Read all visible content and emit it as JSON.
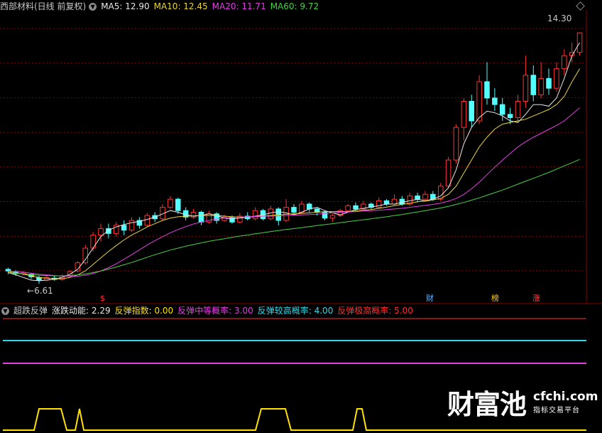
{
  "header": {
    "title": "西部材料(日线 前复权)",
    "ma": [
      {
        "label": "MA5: 12.90",
        "color": "#e8e8e8"
      },
      {
        "label": "MA10: 12.45",
        "color": "#e8d63a"
      },
      {
        "label": "MA20: 11.71",
        "color": "#e23ee2"
      },
      {
        "label": "MA60: 9.72",
        "color": "#46d246"
      }
    ]
  },
  "price_labels": {
    "high": "14.30",
    "low": "6.61"
  },
  "event_marks": [
    {
      "label": "$",
      "color": "#ff3030"
    },
    {
      "label": "财",
      "color": "#5fb4ff"
    },
    {
      "label": "榜",
      "color": "#ffd200"
    },
    {
      "label": "涨",
      "color": "#ff5050"
    }
  ],
  "indicator": {
    "title": "超跌反弹",
    "items": [
      {
        "label": "涨跌动能: 2.29",
        "color": "#e8e8e8"
      },
      {
        "label": "反弹指数: 0.00",
        "color": "#ffe000"
      },
      {
        "label": "反弹中等概率: 3.00",
        "color": "#e23ee2"
      },
      {
        "label": "反弹较高概率: 4.00",
        "color": "#30d8e8"
      },
      {
        "label": "反弹极高概率: 5.00",
        "color": "#ff3030"
      }
    ]
  },
  "watermark": {
    "brand": "财富池",
    "domain": "cfchi.com",
    "tagline": "指标交易平台"
  },
  "colors": {
    "up": "#ff3232",
    "down": "#54ffff",
    "grid": "#8b0000",
    "ma5": "#e8e8e8",
    "ma10": "#e8d63a",
    "ma20": "#e23ee2",
    "ma60": "#46d246"
  },
  "chart_data": {
    "type": "candlestick",
    "y_range": [
      6.0,
      15.0
    ],
    "grid": true,
    "series": [
      {
        "name": "MA5",
        "values": [
          6.95,
          6.88,
          6.8,
          6.72,
          6.7,
          6.72,
          6.75,
          6.8,
          6.9,
          7.05,
          7.35,
          7.7,
          8.05,
          8.25,
          8.35,
          8.42,
          8.48,
          8.52,
          8.58,
          8.65,
          8.75,
          8.85,
          8.8,
          8.72,
          8.68,
          8.7,
          8.75,
          8.7,
          8.62,
          8.6,
          8.62,
          8.65,
          8.68,
          8.72,
          8.78,
          8.82,
          8.78,
          8.72,
          8.8,
          8.9,
          8.95,
          8.85,
          8.78,
          8.72,
          8.8,
          8.88,
          8.92,
          8.96,
          9.0,
          9.05,
          9.05,
          9.1,
          9.15,
          9.2,
          9.15,
          9.2,
          9.3,
          9.55,
          10.1,
          10.9,
          11.4,
          11.7,
          11.9,
          11.85,
          11.75,
          11.6,
          11.55,
          11.8,
          12.1,
          12.1,
          12.05,
          12.3,
          12.9,
          13.6,
          14.0
        ]
      },
      {
        "name": "MA10",
        "values": [
          6.98,
          6.94,
          6.9,
          6.85,
          6.8,
          6.78,
          6.76,
          6.76,
          6.8,
          6.88,
          7.0,
          7.2,
          7.4,
          7.6,
          7.78,
          7.95,
          8.1,
          8.22,
          8.35,
          8.45,
          8.55,
          8.62,
          8.66,
          8.68,
          8.69,
          8.7,
          8.7,
          8.7,
          8.68,
          8.66,
          8.65,
          8.65,
          8.66,
          8.68,
          8.7,
          8.72,
          8.74,
          8.75,
          8.76,
          8.78,
          8.8,
          8.82,
          8.82,
          8.82,
          8.82,
          8.84,
          8.86,
          8.88,
          8.92,
          8.96,
          9.0,
          9.04,
          9.08,
          9.12,
          9.14,
          9.18,
          9.22,
          9.35,
          9.6,
          10.0,
          10.4,
          10.8,
          11.1,
          11.35,
          11.5,
          11.55,
          11.6,
          11.65,
          11.75,
          11.85,
          11.95,
          12.1,
          12.35,
          12.8,
          13.2
        ]
      },
      {
        "name": "MA20",
        "values": [
          7.0,
          6.98,
          6.96,
          6.93,
          6.9,
          6.88,
          6.86,
          6.84,
          6.83,
          6.84,
          6.87,
          6.92,
          7.0,
          7.1,
          7.22,
          7.36,
          7.5,
          7.65,
          7.8,
          7.93,
          8.05,
          8.17,
          8.27,
          8.36,
          8.44,
          8.5,
          8.55,
          8.59,
          8.62,
          8.64,
          8.65,
          8.66,
          8.67,
          8.68,
          8.68,
          8.69,
          8.7,
          8.71,
          8.72,
          8.73,
          8.74,
          8.76,
          8.78,
          8.8,
          8.81,
          8.82,
          8.84,
          8.85,
          8.86,
          8.88,
          8.9,
          8.92,
          8.95,
          8.98,
          9.01,
          9.04,
          9.08,
          9.14,
          9.22,
          9.35,
          9.52,
          9.72,
          9.95,
          10.18,
          10.4,
          10.6,
          10.8,
          10.96,
          11.1,
          11.22,
          11.34,
          11.46,
          11.6,
          11.8,
          12.0
        ]
      },
      {
        "name": "MA60",
        "values": [
          6.95,
          6.93,
          6.91,
          6.89,
          6.87,
          6.86,
          6.85,
          6.85,
          6.86,
          6.88,
          6.91,
          6.95,
          7.0,
          7.06,
          7.12,
          7.19,
          7.26,
          7.34,
          7.42,
          7.5,
          7.57,
          7.64,
          7.7,
          7.76,
          7.81,
          7.86,
          7.91,
          7.95,
          7.99,
          8.03,
          8.07,
          8.1,
          8.14,
          8.17,
          8.21,
          8.24,
          8.27,
          8.3,
          8.33,
          8.36,
          8.39,
          8.42,
          8.45,
          8.48,
          8.51,
          8.54,
          8.57,
          8.6,
          8.63,
          8.66,
          8.7,
          8.73,
          8.77,
          8.81,
          8.85,
          8.89,
          8.93,
          8.98,
          9.04,
          9.1,
          9.17,
          9.24,
          9.32,
          9.4,
          9.48,
          9.57,
          9.66,
          9.75,
          9.84,
          9.93,
          10.02,
          10.12,
          10.22,
          10.32,
          10.42
        ]
      }
    ],
    "candles": [
      [
        7.05,
        7.0,
        7.1,
        6.9
      ],
      [
        6.98,
        6.92,
        7.02,
        6.85
      ],
      [
        6.92,
        6.95,
        7.0,
        6.86
      ],
      [
        6.9,
        6.82,
        6.94,
        6.75
      ],
      [
        6.8,
        6.72,
        6.85,
        6.61
      ],
      [
        6.72,
        6.8,
        6.85,
        6.68
      ],
      [
        6.78,
        6.74,
        6.84,
        6.7
      ],
      [
        6.75,
        6.85,
        6.9,
        6.7
      ],
      [
        6.86,
        6.98,
        7.02,
        6.82
      ],
      [
        7.0,
        7.25,
        7.3,
        6.95
      ],
      [
        7.25,
        7.7,
        7.8,
        7.2
      ],
      [
        7.7,
        8.1,
        8.2,
        7.6
      ],
      [
        8.1,
        8.3,
        8.45,
        7.9
      ],
      [
        8.3,
        8.15,
        8.45,
        8.0
      ],
      [
        8.15,
        8.4,
        8.5,
        8.05
      ],
      [
        8.4,
        8.25,
        8.55,
        8.1
      ],
      [
        8.25,
        8.55,
        8.65,
        8.2
      ],
      [
        8.55,
        8.4,
        8.65,
        8.3
      ],
      [
        8.4,
        8.7,
        8.78,
        8.35
      ],
      [
        8.7,
        8.6,
        8.8,
        8.5
      ],
      [
        8.6,
        8.95,
        9.05,
        8.55
      ],
      [
        8.95,
        9.2,
        9.3,
        8.9
      ],
      [
        9.2,
        8.85,
        9.25,
        8.75
      ],
      [
        8.85,
        8.65,
        8.95,
        8.55
      ],
      [
        8.65,
        8.8,
        8.9,
        8.6
      ],
      [
        8.8,
        8.5,
        8.85,
        8.4
      ],
      [
        8.5,
        8.75,
        8.85,
        8.45
      ],
      [
        8.75,
        8.55,
        8.8,
        8.45
      ],
      [
        8.55,
        8.65,
        8.72,
        8.5
      ],
      [
        8.65,
        8.5,
        8.7,
        8.45
      ],
      [
        8.5,
        8.68,
        8.78,
        8.45
      ],
      [
        8.68,
        8.6,
        8.8,
        8.55
      ],
      [
        8.6,
        8.85,
        8.95,
        8.55
      ],
      [
        8.85,
        8.6,
        8.9,
        8.55
      ],
      [
        8.6,
        8.9,
        9.0,
        8.55
      ],
      [
        8.9,
        8.55,
        8.95,
        8.4
      ],
      [
        8.55,
        8.95,
        9.2,
        8.5
      ],
      [
        8.95,
        8.8,
        9.05,
        8.7
      ],
      [
        8.8,
        9.05,
        9.15,
        8.75
      ],
      [
        9.05,
        8.9,
        9.1,
        8.8
      ],
      [
        8.9,
        8.8,
        8.95,
        8.7
      ],
      [
        8.8,
        8.62,
        8.85,
        8.55
      ],
      [
        8.62,
        8.7,
        8.75,
        8.5
      ],
      [
        8.7,
        8.85,
        8.9,
        8.65
      ],
      [
        8.85,
        9.0,
        9.05,
        8.8
      ],
      [
        9.0,
        8.9,
        9.1,
        8.85
      ],
      [
        8.9,
        9.05,
        9.15,
        8.85
      ],
      [
        9.05,
        8.95,
        9.1,
        8.9
      ],
      [
        8.95,
        9.15,
        9.25,
        8.9
      ],
      [
        9.15,
        9.05,
        9.2,
        9.0
      ],
      [
        9.05,
        9.2,
        9.35,
        9.0
      ],
      [
        9.2,
        9.05,
        9.3,
        9.0
      ],
      [
        9.05,
        9.3,
        9.4,
        9.0
      ],
      [
        9.3,
        9.2,
        9.4,
        9.1
      ],
      [
        9.2,
        9.35,
        9.45,
        9.15
      ],
      [
        9.35,
        9.2,
        9.45,
        9.15
      ],
      [
        9.2,
        9.6,
        9.7,
        9.15
      ],
      [
        9.6,
        10.4,
        10.5,
        9.55
      ],
      [
        10.4,
        11.4,
        11.5,
        10.3
      ],
      [
        11.4,
        12.2,
        12.3,
        11.0
      ],
      [
        12.2,
        11.6,
        12.4,
        11.4
      ],
      [
        11.6,
        12.8,
        13.0,
        11.5
      ],
      [
        12.8,
        12.3,
        13.4,
        12.1
      ],
      [
        12.3,
        12.1,
        12.6,
        11.9
      ],
      [
        12.1,
        11.8,
        12.3,
        11.6
      ],
      [
        11.8,
        11.7,
        12.0,
        11.5
      ],
      [
        11.7,
        12.2,
        12.4,
        11.6
      ],
      [
        12.2,
        13.0,
        13.6,
        12.0
      ],
      [
        13.0,
        12.4,
        13.3,
        12.2
      ],
      [
        12.4,
        12.9,
        13.4,
        12.3
      ],
      [
        12.9,
        12.6,
        13.2,
        12.4
      ],
      [
        12.6,
        13.2,
        13.4,
        12.5
      ],
      [
        13.2,
        13.6,
        13.8,
        13.0
      ],
      [
        13.6,
        13.7,
        14.0,
        13.4
      ],
      [
        13.7,
        14.3,
        14.3,
        13.6
      ]
    ],
    "signal": {
      "name": "反弹指数",
      "values": [
        0,
        0,
        0,
        0,
        0,
        0,
        0,
        0,
        0,
        0,
        0,
        0,
        0,
        0,
        0,
        0,
        0,
        0,
        0,
        0,
        0,
        0,
        0,
        0,
        0,
        0,
        0,
        0,
        0,
        0,
        0,
        0,
        0,
        0,
        0,
        0,
        0,
        0,
        0,
        0,
        0,
        0,
        0,
        0,
        0,
        0,
        0,
        0,
        0,
        0,
        0,
        0,
        0,
        0,
        0,
        0,
        0,
        0,
        0,
        0,
        0,
        0,
        0,
        0,
        0,
        0,
        0,
        0,
        0,
        0,
        0,
        0,
        0,
        0,
        0
      ]
    }
  }
}
